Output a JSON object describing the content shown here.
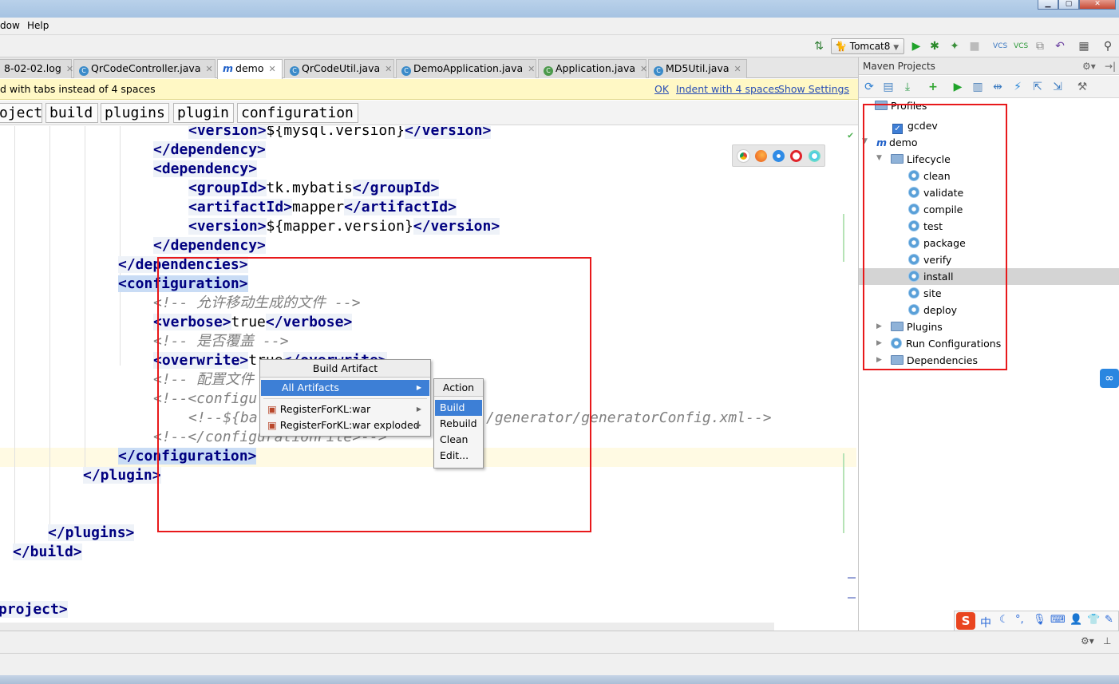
{
  "menu": {
    "items": [
      "dow",
      "Help"
    ]
  },
  "toolbar": {
    "run_config": "Tomcat8"
  },
  "tabs": [
    {
      "label": "8-02-02.log"
    },
    {
      "label": "QrCodeController.java"
    },
    {
      "label": "demo"
    },
    {
      "label": "QrCodeUtil.java"
    },
    {
      "label": "DemoApplication.java"
    },
    {
      "label": "Application.java"
    },
    {
      "label": "MD5Util.java"
    }
  ],
  "notification": {
    "text": "d with tabs instead of 4 spaces",
    "ok": "OK",
    "indent": "Indent with 4 spaces",
    "settings": "Show Settings"
  },
  "breadcrumbs": [
    "oject",
    "build",
    "plugins",
    "plugin",
    "configuration"
  ],
  "code": {
    "l1_open": "<version>",
    "l1_val": "${mysql.version}",
    "l1_close": "</version>",
    "l2": "</dependency>",
    "l3": "<dependency>",
    "l4_open": "<groupId>",
    "l4_val": "tk.mybatis",
    "l4_close": "</groupId>",
    "l5_open": "<artifactId>",
    "l5_val": "mapper",
    "l5_close": "</artifactId>",
    "l6_open": "<version>",
    "l6_val": "${mapper.version}",
    "l6_close": "</version>",
    "l7": "</dependency>",
    "l8": "</dependencies>",
    "l9": "<configuration>",
    "l10": "<!-- 允许移动生成的文件 -->",
    "l11_open": "<verbose>",
    "l11_val": "true",
    "l11_close": "</verbose>",
    "l12": "<!-- 是否覆盖 -->",
    "l13_open": "<overwrite>",
    "l13_val": "true",
    "l13_close": "</overwrite>",
    "l14": "<!-- 配置文件",
    "l15": "<!--<configu",
    "l16a": "<!--${ba",
    "l16b": "/generator/generatorConfig.xml-->",
    "l17": "<!--</configurationFile>-->",
    "l18": "</configuration>",
    "l19": "</plugin>",
    "l20": "</plugins>",
    "l21": "</build>",
    "l22": "project>"
  },
  "context_menu": {
    "title": "Build Artifact",
    "items": [
      {
        "label": "All Artifacts",
        "selected": true
      },
      {
        "label": "RegisterForKL:war",
        "selected": false
      },
      {
        "label": "RegisterForKL:war exploded",
        "selected": false
      }
    ]
  },
  "action_menu": {
    "title": "Action",
    "items": [
      {
        "label": "Build",
        "selected": true
      },
      {
        "label": "Rebuild",
        "selected": false
      },
      {
        "label": "Clean",
        "selected": false
      },
      {
        "label": "Edit...",
        "selected": false
      }
    ]
  },
  "maven": {
    "title": "Maven Projects",
    "profiles": "Profiles",
    "profile_item": "gcdev",
    "project": "demo",
    "lifecycle": "Lifecycle",
    "phases": [
      "clean",
      "validate",
      "compile",
      "test",
      "package",
      "verify",
      "install",
      "site",
      "deploy"
    ],
    "selected_phase": "install",
    "plugins": "Plugins",
    "run_configurations": "Run Configurations",
    "dependencies": "Dependencies"
  },
  "ime": {
    "label": "中"
  },
  "colors": {
    "highlight_box": "#e8191b",
    "selection": "#3d7fd6",
    "xml_tag": "#000080",
    "comment": "#808080"
  }
}
